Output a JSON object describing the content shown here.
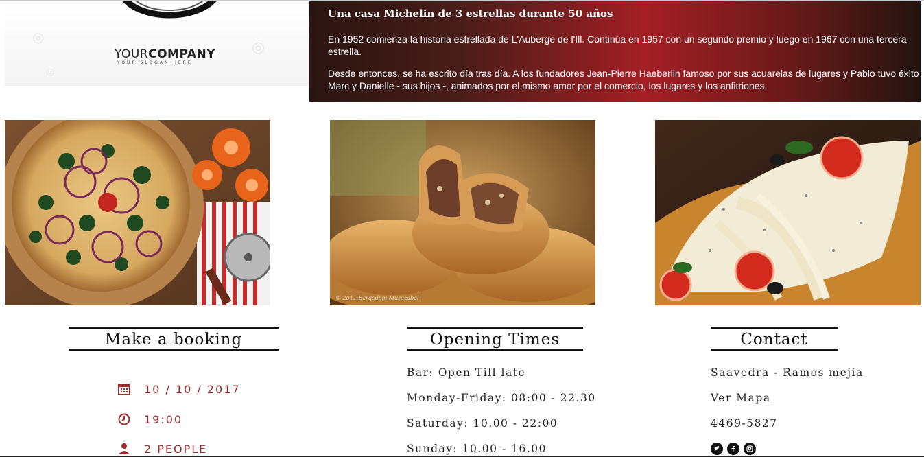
{
  "logo": {
    "company_light": "YOUR",
    "company_bold": "COMPANY",
    "slogan": "YOUR SLOGAN HERE"
  },
  "hero": {
    "title": "Una casa Michelin de 3 estrellas durante 50 años",
    "paragraph1": "En 1952 comienza la historia estrellada de L'Auberge de l'Ill. Continúa en 1957 con un segundo premio y luego en 1967 con una tercera estrella.",
    "paragraph2_line1": "Desde entonces, se ha escrito día tras día. A los fundadores Jean-Pierre Haeberlin famoso por sus acuarelas de lugares y Pablo tuvo éxito",
    "paragraph2_line2": "Marc y Danielle - sus hijos -, animados por el mismo amor por el comercio, los lugares y los anfitriones."
  },
  "photos": [
    {
      "subject": "vegetable-pizza"
    },
    {
      "subject": "empanadas",
      "credit": "© 2011 Bergedom Muruzabal"
    },
    {
      "subject": "cheese-pizza-slice"
    }
  ],
  "booking": {
    "heading": "Make a booking",
    "date": "10 / 10 / 2017",
    "time": "19:00",
    "people": "2 PEOPLE",
    "date_icon": "calendar-icon",
    "time_icon": "clock-icon",
    "people_icon": "people-icon",
    "accent_color": "#9b2b2b"
  },
  "opening_times": {
    "heading": "Opening Times",
    "lines": [
      "Bar: Open Till late",
      "Monday-Friday: 08:00 - 22.30",
      "Saturday: 10.00 - 22:00",
      "Sunday: 10.00 - 16.00"
    ]
  },
  "contact": {
    "heading": "Contact",
    "address": "Saavedra - Ramos mejia",
    "map_link": "Ver Mapa",
    "phone": "4469-5827",
    "social_icons": [
      "twitter-icon",
      "facebook-icon",
      "instagram-icon"
    ]
  }
}
